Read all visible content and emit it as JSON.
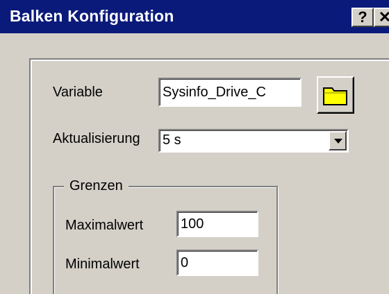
{
  "window": {
    "title": "Balken Konfiguration",
    "help_label": "?",
    "close_label": "✕"
  },
  "form": {
    "variable_label": "Variable",
    "variable_value": "Sysinfo_Drive_C",
    "browse_icon": "folder-icon",
    "update_label": "Aktualisierung",
    "update_value": "5 s",
    "limits_group_label": "Grenzen",
    "max_label": "Maximalwert",
    "max_value": "100",
    "min_label": "Minimalwert",
    "min_value": "0"
  },
  "colors": {
    "titlebar": "#0a1a7a",
    "dialog_bg": "#d4d0c8",
    "folder_icon": "#ffff00"
  }
}
